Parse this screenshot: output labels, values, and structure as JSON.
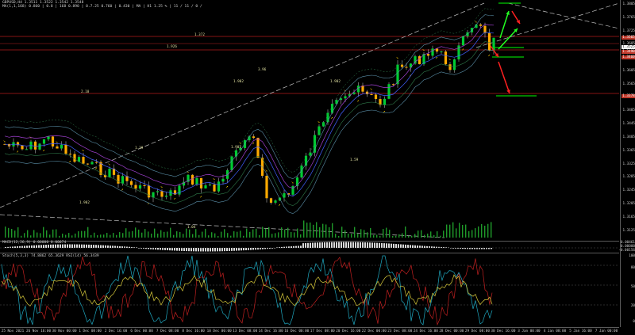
{
  "chart_header": {
    "line1": "GBPUSD,H4  1.3511 1.3522 1.3542 1.3548",
    "line2": "MA(1,1,168)  0.860 | 0.8   |  168   0.890 |  0.7.25   0.760  |  0.430  |  MA  |  H1   1.25 %  |  11 / 11 / 0 /"
  },
  "price_axis": {
    "labels": [
      "1.3805",
      "1.3765",
      "1.3725",
      "1.3685",
      "1.3645",
      "1.3605",
      "1.3565",
      "1.3525",
      "1.3485",
      "1.3445",
      "1.3405",
      "1.3365",
      "1.3325",
      "1.3285",
      "1.3245",
      "1.3205",
      "1.3165",
      "1.3125"
    ],
    "tags": [
      {
        "text": "1.3565",
        "color": "#c0392b"
      },
      {
        "text": "1.3525",
        "color": "#ffffff"
      },
      {
        "text": "1.3490",
        "color": "#c0392b"
      },
      {
        "text": "1.3460",
        "color": "#c0392b"
      },
      {
        "text": "1.3378",
        "color": "#c0392b"
      }
    ]
  },
  "chart_annotations": [
    "1.372",
    "1.926",
    "1.902",
    "1.902",
    "2.10",
    "1.902",
    "3.96",
    "1.04",
    "1.902",
    "1.39",
    "1.59"
  ],
  "macd": {
    "label": "MACD(12,26,9)  0.00000  0.00074",
    "axis": [
      "0.00461",
      "0.00000",
      "-0.00156"
    ]
  },
  "stoch": {
    "label": "Stoch(5,3,3)  74.8862  65.3629  RSI(14)  56.3439",
    "axis": [
      "100",
      "80",
      "50",
      "20",
      "0"
    ]
  },
  "time_axis": [
    "25 Nov 2021",
    "26 Nov 16:00",
    "30 Nov 00:00",
    "1 Dec 08:00",
    "2 Dec 16:00",
    "6 Dec 00:00",
    "7 Dec 08:00",
    "8 Dec 16:00",
    "10 Dec 00:00",
    "13 Dec 08:00",
    "14 Dec 16:00",
    "16 Dec 00:00",
    "17 Dec 08:00",
    "20 Dec 16:00",
    "22 Dec 00:00",
    "23 Dec 08:00",
    "24 Dec 16:00",
    "28 Dec 00:00",
    "29 Dec 08:00",
    "30 Dec 16:00",
    "3 Jan 00:00",
    "4 Jan 08:00",
    "5 Jan 16:00",
    "7 Jan 00:00"
  ],
  "colors": {
    "bull": "#00cc33",
    "bear": "#ffaa00",
    "wick": "#cfcfcf",
    "resistance": "#b31b1b",
    "target": "#00cc00",
    "arrow_up": "#22ff22",
    "arrow_down": "#ff2020",
    "trend": "#bfbfbf"
  }
}
